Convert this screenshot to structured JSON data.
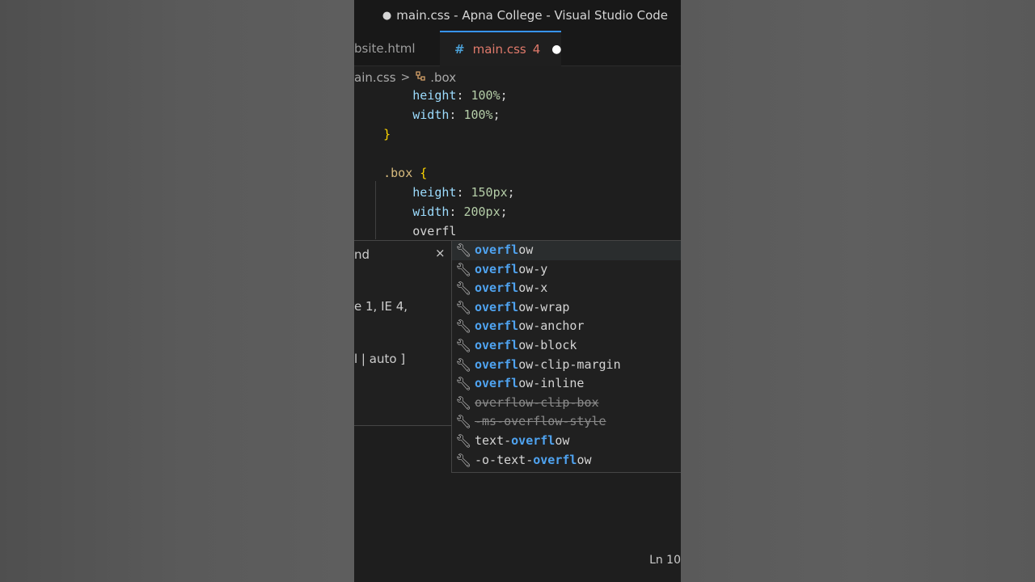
{
  "window": {
    "unsaved_dot": "●",
    "title": "main.css - Apna College - Visual Studio Code"
  },
  "tabs": [
    {
      "label": "bsite.html",
      "active": false
    },
    {
      "icon": "#",
      "label": "main.css",
      "problems": "4",
      "unsaved_marker": "●",
      "active": true
    }
  ],
  "breadcrumb": {
    "file": "ain.css",
    "separator": ">",
    "symbol": ".box"
  },
  "code": {
    "line1": {
      "prop": "height",
      "colon": ":",
      "value": "100%",
      "semi": ";"
    },
    "line2": {
      "prop": "width",
      "colon": ":",
      "value": "100%",
      "semi": ";"
    },
    "line3": {
      "brace": "}"
    },
    "line5": {
      "selector": ".box",
      "brace": "{"
    },
    "line6": {
      "prop": "height",
      "colon": ":",
      "value": "150px",
      "semi": ";"
    },
    "line7": {
      "prop": "width",
      "colon": ":",
      "value": "200px",
      "semi": ";"
    },
    "line8": {
      "typed": "overfl"
    }
  },
  "hover_panel": {
    "title": "nd",
    "close_icon": "×",
    "line1": "e 1, IE 4,",
    "line2": "l | auto ]"
  },
  "suggestions": [
    {
      "match": "overfl",
      "rest": "ow",
      "selected": true,
      "deprecated": false
    },
    {
      "match": "overfl",
      "rest": "ow-y",
      "selected": false,
      "deprecated": false
    },
    {
      "match": "overfl",
      "rest": "ow-x",
      "selected": false,
      "deprecated": false
    },
    {
      "match": "overfl",
      "rest": "ow-wrap",
      "selected": false,
      "deprecated": false
    },
    {
      "match": "overfl",
      "rest": "ow-anchor",
      "selected": false,
      "deprecated": false
    },
    {
      "match": "overfl",
      "rest": "ow-block",
      "selected": false,
      "deprecated": false
    },
    {
      "match": "overfl",
      "rest": "ow-clip-margin",
      "selected": false,
      "deprecated": false
    },
    {
      "match": "overfl",
      "rest": "ow-inline",
      "selected": false,
      "deprecated": false
    },
    {
      "text": "overflow-clip-box",
      "selected": false,
      "deprecated": true
    },
    {
      "text": "-ms-overflow-style",
      "selected": false,
      "deprecated": true
    },
    {
      "prefix": "text-",
      "match": "overfl",
      "rest": "ow",
      "selected": false,
      "deprecated": false
    },
    {
      "prefix": "-o-text-",
      "match": "overfl",
      "rest": "ow",
      "selected": false,
      "deprecated": false
    }
  ],
  "statusbar": {
    "position": "Ln 10"
  }
}
